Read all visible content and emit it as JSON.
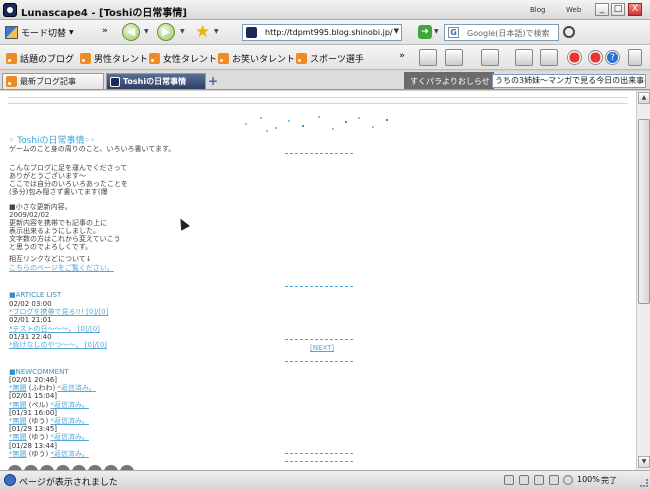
{
  "window": {
    "title": "Lunascape4 - [Toshiの日常事情]",
    "links": [
      "Blog",
      "Web"
    ],
    "controls": [
      "_",
      "□",
      "X"
    ]
  },
  "toolbar": {
    "mode_label": "モード切替",
    "url": "http://tdpmt995.blog.shinobi.jp/",
    "search_placeholder": "Google(日本語)で検索"
  },
  "bookmarks": {
    "items": [
      "話題のブログ",
      "男性タレント",
      "女性タレント",
      "お笑いタレント",
      "スポーツ選手"
    ]
  },
  "tabs": [
    {
      "label": "最新ブログ記事",
      "active": false
    },
    {
      "label": "Toshiの日常事情",
      "active": true
    }
  ],
  "ticker": {
    "label": "すくパラよりおしらせ",
    "text": "うちの3姉妹〜マンガで見る今日の出来事〜"
  },
  "blog": {
    "title": "◦ Toshiの日常事情◦◦",
    "description": "ゲームのこと身の周りのこと、いろいろ書いてます。",
    "intro": "こんなブログに足を運んでくださって\nありがとうございます～\nここでは自分のいろいろあったことを\n(多分)包み隠さず書いてます(爆",
    "update_note": "■小さな更新内容。\n2009/02/02\n更新内容を携帯でも記事の上に\n表示出来るようにしました。\n文字数の方はこれから変えていこう\nと思うのでよろしくです。",
    "link_note": "相互リンクなどについて↓",
    "link_text": "こちらのページをご覧ください。",
    "article_head": "■ARTICLE LIST",
    "articles": [
      {
        "date": "02/02 03:00",
        "title": "*ブログを携帯で見る!!! [0]/[0]"
      },
      {
        "date": "02/01 21:01",
        "title": "*テストの日〜〜〜。 [0]/[0]"
      },
      {
        "date": "01/31 22:40",
        "title": "*負けなしのやつ〜〜。 [0]/[0]"
      }
    ],
    "next_label": "[NEXT]",
    "comment_head": "■NEWCOMMENT",
    "comments": [
      {
        "date": "[02/01 20:46]",
        "name": "*無題",
        "who": " (ふわわ) ",
        "status": "*返信済み。"
      },
      {
        "date": "[02/01 15:04]",
        "name": "*無題",
        "who": " (ペル) ",
        "status": "*返信済み。"
      },
      {
        "date": "[01/31 16:00]",
        "name": "*無題",
        "who": " (ゆう) ",
        "status": "*返信済み。"
      },
      {
        "date": "[01/29 13:45]",
        "name": "*無題",
        "who": " (ゆう) ",
        "status": "*返信済み。"
      },
      {
        "date": "[01/28 13:44]",
        "name": "*無題",
        "who": " (ゆう) ",
        "status": "*返信済み。"
      }
    ]
  },
  "status": {
    "text": "ページが表示されました",
    "zoom": "100%",
    "done": "完了"
  },
  "icons": {
    "back": "back-arrow-icon",
    "forward": "forward-arrow-icon",
    "favorites": "star-icon",
    "rss": "rss-feed-icon",
    "search": "magnifier-icon"
  }
}
